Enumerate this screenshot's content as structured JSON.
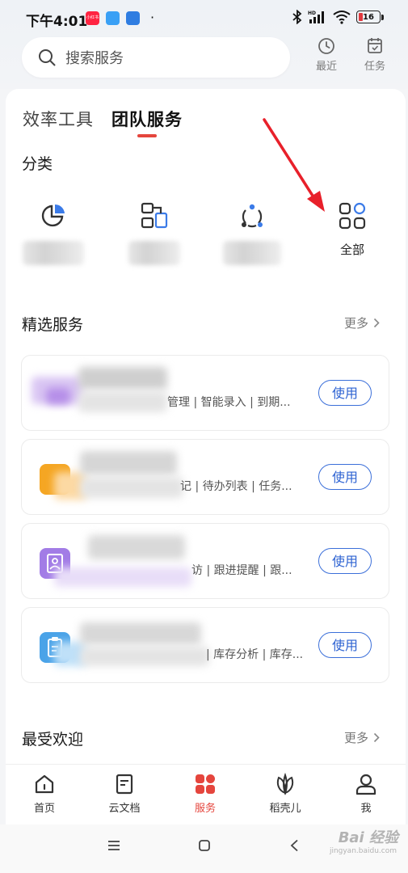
{
  "status_bar": {
    "time": "下午4:01",
    "app_badge_text": "小红书",
    "battery": "16",
    "network": "HD"
  },
  "header": {
    "search_placeholder": "搜索服务",
    "actions": [
      {
        "label": "最近",
        "icon": "clock-icon"
      },
      {
        "label": "任务",
        "icon": "calendar-task-icon"
      }
    ]
  },
  "tabs": [
    {
      "label": "效率工具",
      "active": false
    },
    {
      "label": "团队服务",
      "active": true
    }
  ],
  "categories": {
    "title": "分类",
    "items": [
      {
        "icon": "pie-chart-icon",
        "label": ""
      },
      {
        "icon": "flow-chart-icon",
        "label": ""
      },
      {
        "icon": "circle-nodes-icon",
        "label": ""
      },
      {
        "icon": "grid-apps-icon",
        "label": "全部"
      }
    ]
  },
  "featured": {
    "title": "精选服务",
    "more": "更多",
    "items": [
      {
        "desc": "管理 | 智能录入 | 到期...",
        "button": "使用",
        "icon_color": "#c9a7f0"
      },
      {
        "desc": "记 | 待办列表 | 任务...",
        "button": "使用",
        "icon_color": "#f5a623"
      },
      {
        "desc": "访 | 跟进提醒 | 跟...",
        "button": "使用",
        "icon_color": "#a27ce6"
      },
      {
        "desc": "| 库存分析 | 库存...",
        "button": "使用",
        "icon_color": "#4aa3e8"
      }
    ]
  },
  "popular": {
    "title": "最受欢迎",
    "more": "更多"
  },
  "bottom_nav": [
    {
      "label": "首页",
      "icon": "home-icon",
      "active": false
    },
    {
      "label": "云文档",
      "icon": "document-icon",
      "active": false
    },
    {
      "label": "服务",
      "icon": "apps-grid-icon",
      "active": true
    },
    {
      "label": "稻壳儿",
      "icon": "leaf-icon",
      "active": false
    },
    {
      "label": "我",
      "icon": "person-icon",
      "active": false
    }
  ],
  "colors": {
    "accent_red": "#e5453d",
    "button_blue": "#2e63d2"
  },
  "watermark": {
    "text": "Bai 经验",
    "sub": "jingyan.baidu.com"
  }
}
